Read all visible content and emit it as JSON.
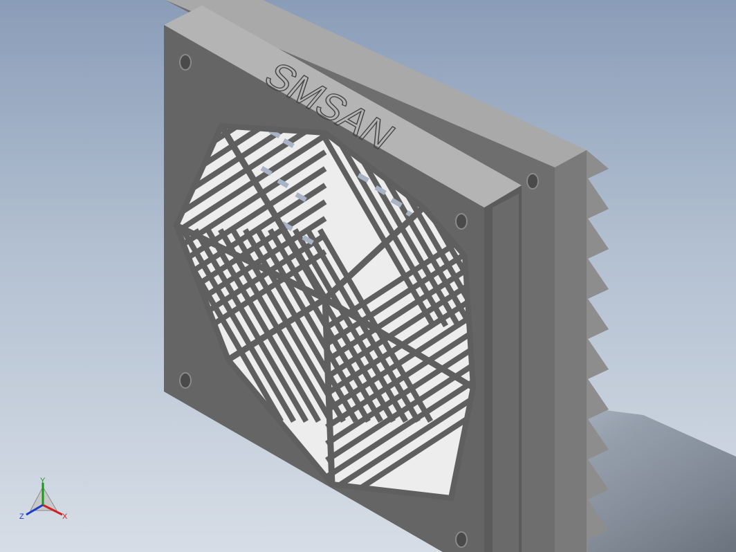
{
  "model": {
    "engraved_text": "SMSAN",
    "colors": {
      "background_top": "#8a9db8",
      "background_bottom": "#d6dde6",
      "face": "#646464",
      "top_edge": "#b2b2b2",
      "side": "#5a5a5a",
      "fins": "#8d8d8d",
      "openings": "#a8b4c6"
    }
  },
  "triad": {
    "x_label": "X",
    "y_label": "Y",
    "z_label": "Z",
    "x_color": "#d02020",
    "y_color": "#1a9a1a",
    "z_color": "#1a3ad0"
  }
}
